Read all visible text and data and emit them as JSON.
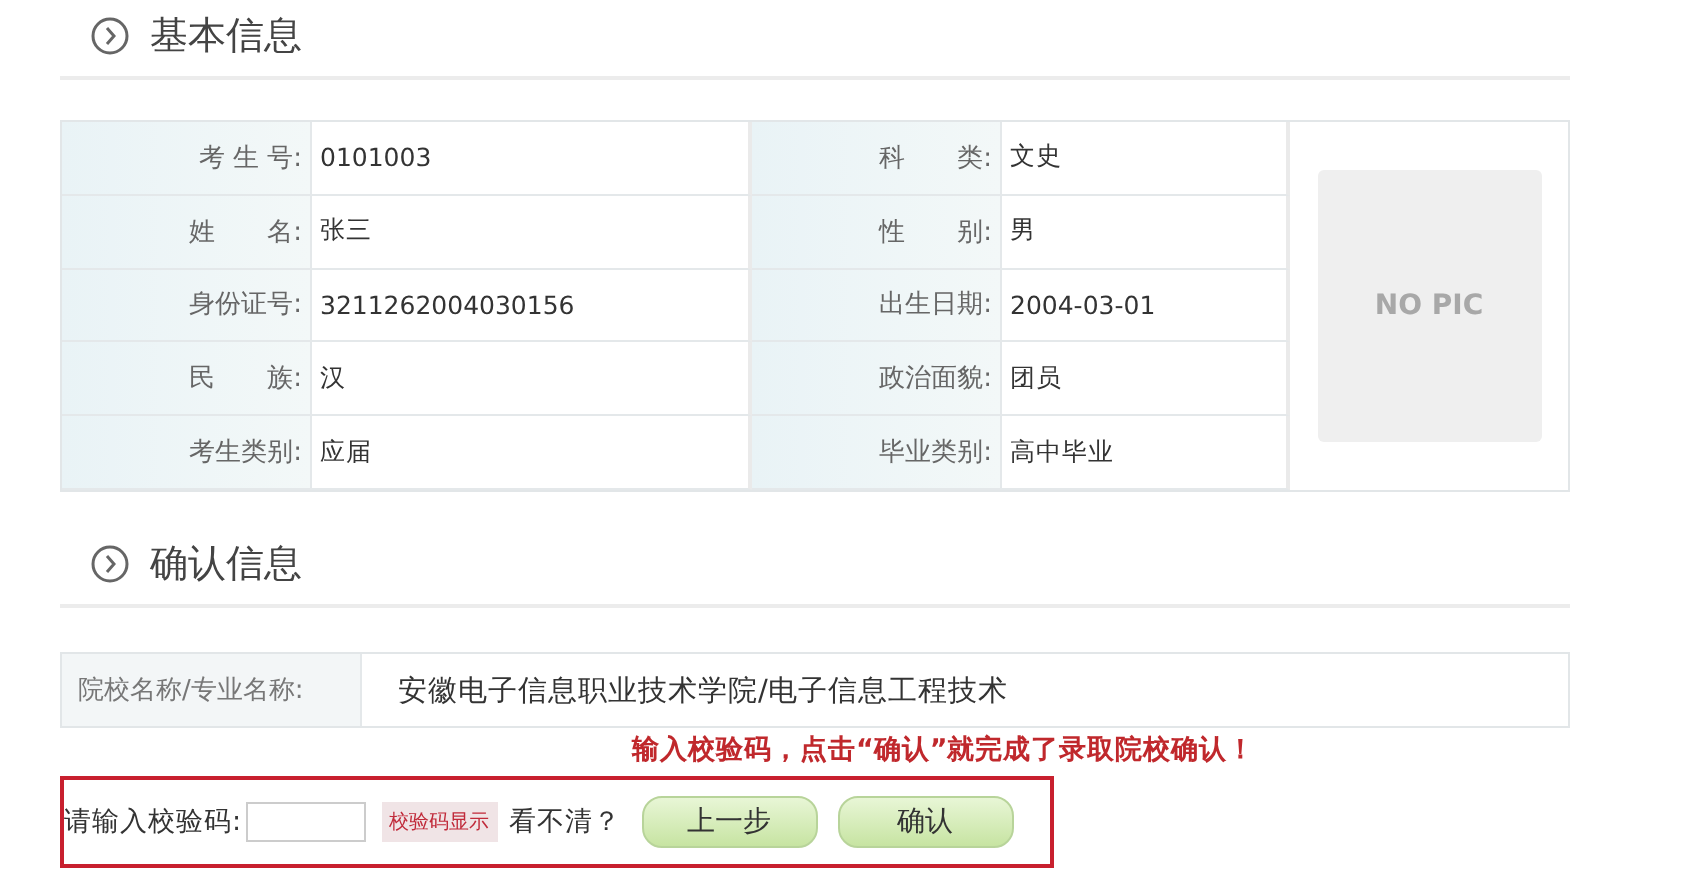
{
  "basic_section": {
    "title": "基本信息"
  },
  "basic_info": {
    "rows": [
      {
        "label": "考 生 号:",
        "value": "0101003",
        "label_2": "科　　类:",
        "value_2": "文史"
      },
      {
        "label": "姓　　名:",
        "value": "张三",
        "label_2": "性　　别:",
        "value_2": "男"
      },
      {
        "label": "身份证号:",
        "value": "3211262004030156",
        "label_2": "出生日期:",
        "value_2": "2004-03-01"
      },
      {
        "label": "民　　族:",
        "value": "汉",
        "label_2": "政治面貌:",
        "value_2": "团员"
      },
      {
        "label": "考生类别:",
        "value": "应届",
        "label_2": "毕业类别:",
        "value_2": "高中毕业"
      }
    ],
    "photo": {
      "text": "NO PIC"
    }
  },
  "confirm_section": {
    "title": "确认信息"
  },
  "school": {
    "label": "院校名称/专业名称:",
    "value": "安徽电子信息职业技术学院/电子信息工程技术"
  },
  "notice": "输入校验码，点击“确认”就完成了录取院校确认！",
  "captcha": {
    "label": "请输入校验码:",
    "captcha_image": "校验码显示",
    "refresh_link": "看不清？"
  },
  "buttons": [
    "上一步",
    "确认"
  ]
}
